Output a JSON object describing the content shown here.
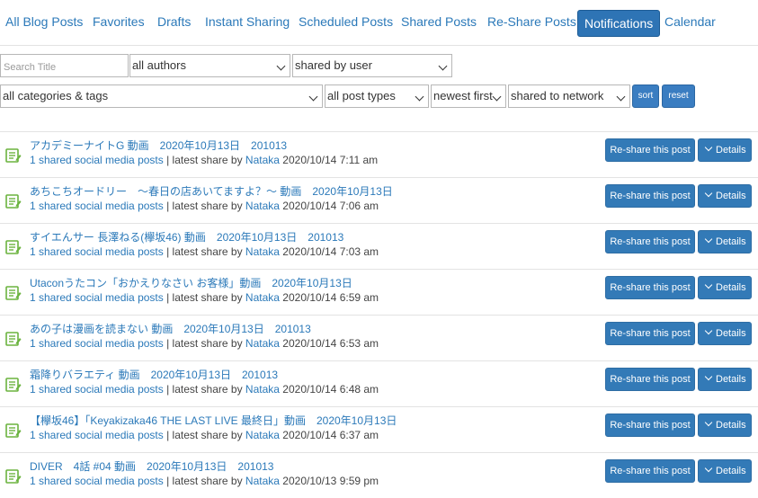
{
  "tabs": [
    {
      "label": "All Blog Posts"
    },
    {
      "label": "Favorites"
    },
    {
      "label": "Drafts"
    },
    {
      "label": "Instant Sharing"
    },
    {
      "label": "Scheduled Posts"
    },
    {
      "label": "Shared Posts"
    },
    {
      "label": "Re-Share Posts"
    },
    {
      "label": "Notifications",
      "active": true
    },
    {
      "label": "Calendar"
    }
  ],
  "filters": {
    "search_placeholder": "Search Title",
    "authors": "all authors",
    "shared_by": "shared by user",
    "categories": "all categories & tags",
    "post_types": "all post types",
    "sort_order": "newest first",
    "network": "shared to network",
    "sort_label": "sort",
    "reset_label": "reset"
  },
  "row_labels": {
    "shared_count": "1 shared social media posts",
    "separator": " | latest share by ",
    "author": "Nataka",
    "reshare": "Re-share this post",
    "details": "Details"
  },
  "rows": [
    {
      "title": "アカデミーナイトG 動画　2020年10月13日　201013",
      "date": "2020/10/14 7:11 am"
    },
    {
      "title": "あちこちオードリー　～春日の店あいてますよ？～ 動画　2020年10月13日",
      "date": "2020/10/14 7:06 am"
    },
    {
      "title": "すイエんサー 長澤ねる(欅坂46) 動画　2020年10月13日　201013",
      "date": "2020/10/14 7:03 am"
    },
    {
      "title": "Utaconうたコン「おかえりなさい お客様」動画　2020年10月13日",
      "date": "2020/10/14 6:59 am"
    },
    {
      "title": "あの子は漫画を読まない 動画　2020年10月13日　201013",
      "date": "2020/10/14 6:53 am"
    },
    {
      "title": "霜降りバラエティ 動画　2020年10月13日　201013",
      "date": "2020/10/14 6:48 am"
    },
    {
      "title": "【欅坂46】「Keyakizaka46 THE LAST LIVE 最終日」動画　2020年10月13日",
      "date": "2020/10/14 6:37 am"
    },
    {
      "title": "DIVER　4話 #04 動画　2020年10月13日　201013",
      "date": "2020/10/13 9:59 pm"
    }
  ],
  "colors": {
    "accent": "#2e74b5",
    "link": "#2b79b9",
    "icon_green": "#6bb33f"
  }
}
